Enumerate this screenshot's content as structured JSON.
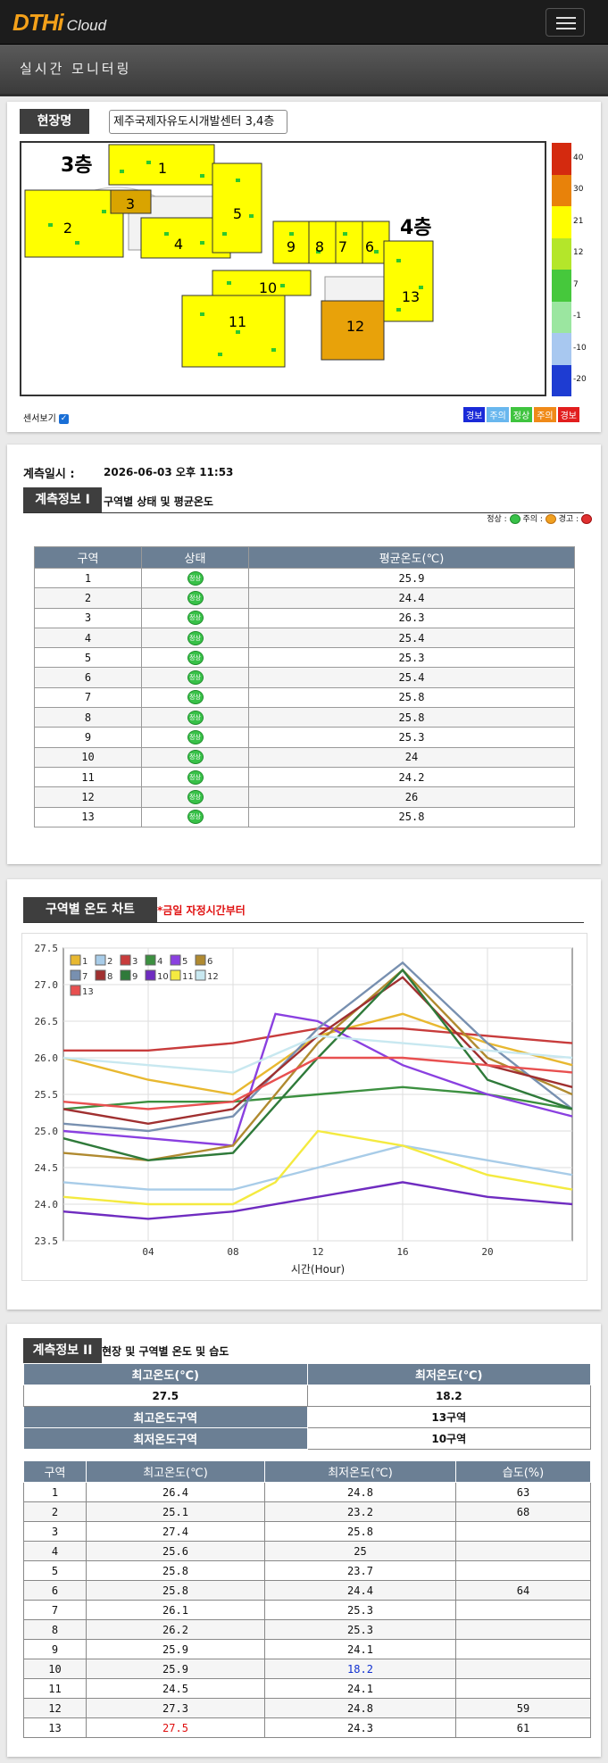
{
  "brand": {
    "name": "DTHi",
    "sub": "Cloud"
  },
  "header": {
    "title": "실시간 모니터링"
  },
  "site": {
    "label": "현장명",
    "selected": "제주국제자유도시개발센터 3,4층",
    "floor3": "3층",
    "floor4": "4층",
    "sensor_label": "센서보기",
    "scale": [
      "40",
      "30",
      "21",
      "12",
      "7",
      "-1",
      "-10",
      "-20"
    ],
    "scale_colors": [
      "#d42a0f",
      "#e8820a",
      "#ffff00",
      "#b4e62a",
      "#46c83c",
      "#9be6a0",
      "#a8c8f0",
      "#1e3cd2"
    ],
    "status_legend": [
      {
        "t": "경보",
        "c": "#1a2ad8"
      },
      {
        "t": "주의",
        "c": "#69b7ee"
      },
      {
        "t": "정상",
        "c": "#3fc43f"
      },
      {
        "t": "주의",
        "c": "#f08a18"
      },
      {
        "t": "경보",
        "c": "#e21e1e"
      }
    ],
    "zones": [
      "1",
      "2",
      "3",
      "4",
      "5",
      "6",
      "7",
      "8",
      "9",
      "10",
      "11",
      "12",
      "13"
    ]
  },
  "info1": {
    "time_label": "계측일시 :",
    "time_value": "2026-06-03 오후 11:53",
    "title": "계측정보 I",
    "subtitle": "구역별 상태 및 평균온도",
    "legend": "정상 : ● 주의 : ● 경고 : ●",
    "headers": [
      "구역",
      "상태",
      "평균온도(℃)"
    ],
    "rows": [
      [
        "1",
        "25.9"
      ],
      [
        "2",
        "24.4"
      ],
      [
        "3",
        "26.3"
      ],
      [
        "4",
        "25.4"
      ],
      [
        "5",
        "25.3"
      ],
      [
        "6",
        "25.4"
      ],
      [
        "7",
        "25.8"
      ],
      [
        "8",
        "25.8"
      ],
      [
        "9",
        "25.3"
      ],
      [
        "10",
        "24"
      ],
      [
        "11",
        "24.2"
      ],
      [
        "12",
        "26"
      ],
      [
        "13",
        "25.8"
      ]
    ],
    "icon_text": "정상"
  },
  "chart_card": {
    "title": "구역별 온도 차트",
    "note": "*금일 자정시간부터"
  },
  "chart_data": {
    "type": "line",
    "xlabel": "시간(Hour)",
    "ylabel": "",
    "xlim": [
      0,
      24
    ],
    "ylim": [
      23.5,
      27.5
    ],
    "x_ticks": [
      "04",
      "08",
      "12",
      "16",
      "20"
    ],
    "y_ticks": [
      "23.5",
      "24.0",
      "24.5",
      "25.0",
      "25.5",
      "26.0",
      "26.5",
      "27.0",
      "27.5"
    ],
    "series": [
      {
        "name": "1",
        "color": "#e8b830",
        "x": [
          0,
          4,
          8,
          12,
          16,
          20,
          24
        ],
        "values": [
          26.0,
          25.7,
          25.5,
          26.3,
          26.6,
          26.2,
          25.9
        ]
      },
      {
        "name": "2",
        "color": "#a8cce8",
        "x": [
          0,
          4,
          8,
          12,
          16,
          20,
          24
        ],
        "values": [
          24.3,
          24.2,
          24.2,
          24.5,
          24.8,
          24.6,
          24.4
        ]
      },
      {
        "name": "3",
        "color": "#c83c3c",
        "x": [
          0,
          4,
          8,
          12,
          16,
          20,
          24
        ],
        "values": [
          26.1,
          26.1,
          26.2,
          26.4,
          26.4,
          26.3,
          26.2
        ]
      },
      {
        "name": "4",
        "color": "#3c9040",
        "x": [
          0,
          4,
          8,
          12,
          16,
          20,
          24
        ],
        "values": [
          25.3,
          25.4,
          25.4,
          25.5,
          25.6,
          25.5,
          25.3
        ]
      },
      {
        "name": "5",
        "color": "#8a40e0",
        "x": [
          0,
          4,
          8,
          10,
          12,
          16,
          20,
          24
        ],
        "values": [
          25.0,
          24.9,
          24.8,
          26.6,
          26.5,
          25.9,
          25.5,
          25.2
        ]
      },
      {
        "name": "6",
        "color": "#b08a30",
        "x": [
          0,
          4,
          8,
          12,
          16,
          20,
          24
        ],
        "values": [
          24.7,
          24.6,
          24.8,
          26.2,
          27.2,
          26.0,
          25.5
        ]
      },
      {
        "name": "7",
        "color": "#7890b0",
        "x": [
          0,
          4,
          8,
          12,
          16,
          20,
          24
        ],
        "values": [
          25.1,
          25.0,
          25.2,
          26.4,
          27.3,
          26.2,
          25.3
        ]
      },
      {
        "name": "8",
        "color": "#a03030",
        "x": [
          0,
          4,
          8,
          12,
          16,
          20,
          24
        ],
        "values": [
          25.3,
          25.1,
          25.3,
          26.3,
          27.1,
          25.9,
          25.6
        ]
      },
      {
        "name": "9",
        "color": "#2f7a3a",
        "x": [
          0,
          4,
          8,
          12,
          16,
          20,
          24
        ],
        "values": [
          24.9,
          24.6,
          24.7,
          26.0,
          27.2,
          25.7,
          25.3
        ]
      },
      {
        "name": "10",
        "color": "#6f2cc0",
        "x": [
          0,
          4,
          8,
          12,
          16,
          20,
          24
        ],
        "values": [
          23.9,
          23.8,
          23.9,
          24.1,
          24.3,
          24.1,
          24.0
        ]
      },
      {
        "name": "11",
        "color": "#f4ea40",
        "x": [
          0,
          4,
          8,
          10,
          12,
          16,
          20,
          24
        ],
        "values": [
          24.1,
          24.0,
          24.0,
          24.3,
          25.0,
          24.8,
          24.4,
          24.2
        ]
      },
      {
        "name": "12",
        "color": "#c8e8f0",
        "x": [
          0,
          4,
          8,
          12,
          16,
          20,
          24
        ],
        "values": [
          26.0,
          25.9,
          25.8,
          26.3,
          26.2,
          26.1,
          26.0
        ]
      },
      {
        "name": "13",
        "color": "#e85050",
        "x": [
          0,
          4,
          8,
          12,
          16,
          20,
          24
        ],
        "values": [
          25.4,
          25.3,
          25.4,
          26.0,
          26.0,
          25.9,
          25.8
        ]
      }
    ]
  },
  "info2": {
    "title": "계측정보 II",
    "subtitle": "현장 및 구역별 온도 및 습도",
    "summary_headers": [
      "최고온도(℃)",
      "최저온도(℃)"
    ],
    "max_temp": "27.5",
    "min_temp": "18.2",
    "max_zone_label": "최고온도구역",
    "max_zone": "13구역",
    "min_zone_label": "최저온도구역",
    "min_zone": "10구역",
    "headers": [
      "구역",
      "최고온도(℃)",
      "최저온도(℃)",
      "습도(%)"
    ],
    "rows": [
      [
        "1",
        "26.4",
        "24.8",
        "63"
      ],
      [
        "2",
        "25.1",
        "23.2",
        "68"
      ],
      [
        "3",
        "27.4",
        "25.8",
        ""
      ],
      [
        "4",
        "25.6",
        "25",
        ""
      ],
      [
        "5",
        "25.8",
        "23.7",
        ""
      ],
      [
        "6",
        "25.8",
        "24.4",
        "64"
      ],
      [
        "7",
        "26.1",
        "25.3",
        ""
      ],
      [
        "8",
        "26.2",
        "25.3",
        ""
      ],
      [
        "9",
        "25.9",
        "24.1",
        ""
      ],
      [
        "10",
        "25.9",
        "18.2",
        ""
      ],
      [
        "11",
        "24.5",
        "24.1",
        ""
      ],
      [
        "12",
        "27.3",
        "24.8",
        "59"
      ],
      [
        "13",
        "27.5",
        "24.3",
        "61"
      ]
    ]
  }
}
